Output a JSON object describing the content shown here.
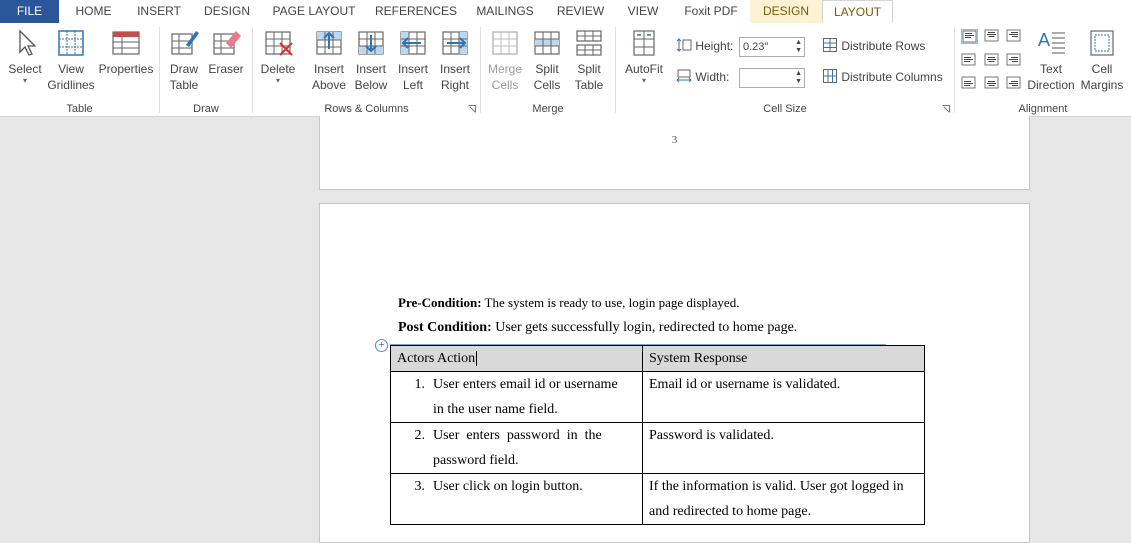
{
  "tabs": [
    {
      "label": "FILE"
    },
    {
      "label": "HOME"
    },
    {
      "label": "INSERT"
    },
    {
      "label": "DESIGN"
    },
    {
      "label": "PAGE LAYOUT"
    },
    {
      "label": "REFERENCES"
    },
    {
      "label": "MAILINGS"
    },
    {
      "label": "REVIEW"
    },
    {
      "label": "VIEW"
    },
    {
      "label": "Foxit PDF"
    },
    {
      "label": "DESIGN"
    },
    {
      "label": "LAYOUT"
    }
  ],
  "ribbon": {
    "groups": {
      "table": "Table",
      "draw": "Draw",
      "rows_columns": "Rows & Columns",
      "merge": "Merge",
      "cell_size": "Cell Size",
      "alignment": "Alignment"
    },
    "buttons": {
      "select": [
        "Select"
      ],
      "view_gridlines": [
        "View",
        "Gridlines"
      ],
      "properties": [
        "Properties"
      ],
      "draw_table": [
        "Draw",
        "Table"
      ],
      "eraser": [
        "Eraser"
      ],
      "delete": [
        "Delete"
      ],
      "insert_above": [
        "Insert",
        "Above"
      ],
      "insert_below": [
        "Insert",
        "Below"
      ],
      "insert_left": [
        "Insert",
        "Left"
      ],
      "insert_right": [
        "Insert",
        "Right"
      ],
      "merge_cells": [
        "Merge",
        "Cells"
      ],
      "split_cells": [
        "Split",
        "Cells"
      ],
      "split_table": [
        "Split",
        "Table"
      ],
      "autofit": [
        "AutoFit"
      ],
      "text_direction": [
        "Text",
        "Direction"
      ],
      "cell_margins": [
        "Cell",
        "Margins"
      ]
    },
    "cell_size": {
      "height_label": "Height:",
      "height_value": "0.23\"",
      "width_label": "Width:",
      "width_value": "",
      "distribute_rows": "Distribute Rows",
      "distribute_columns": "Distribute Columns"
    }
  },
  "document": {
    "page_number": "3",
    "pre_condition_label": "Pre-Condition:",
    "pre_condition_text": " The system is ready to use, login page displayed.",
    "post_condition_label": "Post Condition:",
    "post_condition_text": " User gets successfully login, redirected to home page.",
    "table": {
      "headers": [
        "Actors Action",
        "System Response"
      ],
      "rows": [
        {
          "num": "1.",
          "action_lines": [
            "User enters email id or username",
            "in the user name field."
          ],
          "response_lines": [
            "Email id or username is validated."
          ]
        },
        {
          "num": "2.",
          "action_lines": [
            "User  enters  password  in  the",
            "password field."
          ],
          "response_lines": [
            "Password is validated."
          ]
        },
        {
          "num": "3.",
          "action_lines": [
            "User click on login button."
          ],
          "response_lines": [
            "If the information is valid. User got logged in",
            "and redirected to home page."
          ]
        }
      ]
    }
  },
  "colors": {
    "file_tab": "#2b579a",
    "context_tab": "#7a5a00",
    "header_fill": "#d9d9d9"
  }
}
